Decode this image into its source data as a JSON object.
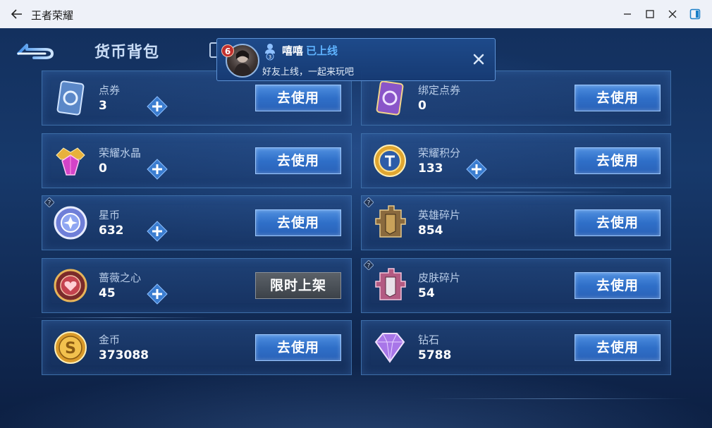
{
  "window": {
    "title": "王者荣耀",
    "controls": [
      "back-icon",
      "minimize-icon",
      "maximize-icon",
      "close-icon",
      "sidebar-toggle-icon"
    ]
  },
  "page": {
    "title": "货币背包"
  },
  "notification": {
    "badge": "6",
    "level": "3",
    "name": "嘻嘻",
    "status": "已上线",
    "message": "好友上线，一起来玩吧"
  },
  "currencies": [
    {
      "id": "dianquan",
      "label": "点券",
      "value": "3",
      "icon": "ticket-card-icon",
      "has_plus": true,
      "has_help": false,
      "button": "去使用"
    },
    {
      "id": "bangding",
      "label": "绑定点券",
      "value": "0",
      "icon": "bound-ticket-card-icon",
      "has_plus": false,
      "has_help": false,
      "button": "去使用"
    },
    {
      "id": "shuijing",
      "label": "荣耀水晶",
      "value": "0",
      "icon": "crystal-crown-icon",
      "has_plus": true,
      "has_help": false,
      "button": "去使用"
    },
    {
      "id": "jifen",
      "label": "荣耀积分",
      "value": "133",
      "icon": "points-coin-icon",
      "has_plus": true,
      "has_help": false,
      "button": "去使用"
    },
    {
      "id": "xingbi",
      "label": "星币",
      "value": "632",
      "icon": "star-coin-icon",
      "has_plus": true,
      "has_help": true,
      "button": "去使用"
    },
    {
      "id": "yingxiong",
      "label": "英雄碎片",
      "value": "854",
      "icon": "hero-fragment-icon",
      "has_plus": false,
      "has_help": true,
      "button": "去使用"
    },
    {
      "id": "qiangwei",
      "label": "蔷薇之心",
      "value": "45",
      "icon": "rose-heart-icon",
      "has_plus": true,
      "has_help": false,
      "button": "限时上架"
    },
    {
      "id": "pifu",
      "label": "皮肤碎片",
      "value": "54",
      "icon": "skin-fragment-icon",
      "has_plus": false,
      "has_help": true,
      "button": "去使用"
    },
    {
      "id": "jinbi",
      "label": "金币",
      "value": "373088",
      "icon": "gold-coin-icon",
      "has_plus": false,
      "has_help": false,
      "button": "去使用"
    },
    {
      "id": "zuanshi",
      "label": "钻石",
      "value": "5788",
      "icon": "diamond-icon",
      "has_plus": false,
      "has_help": false,
      "button": "去使用"
    }
  ],
  "colors": {
    "accent_button": "#3a7ad4",
    "status_online": "#5fb3ff",
    "badge": "#c0302e"
  }
}
